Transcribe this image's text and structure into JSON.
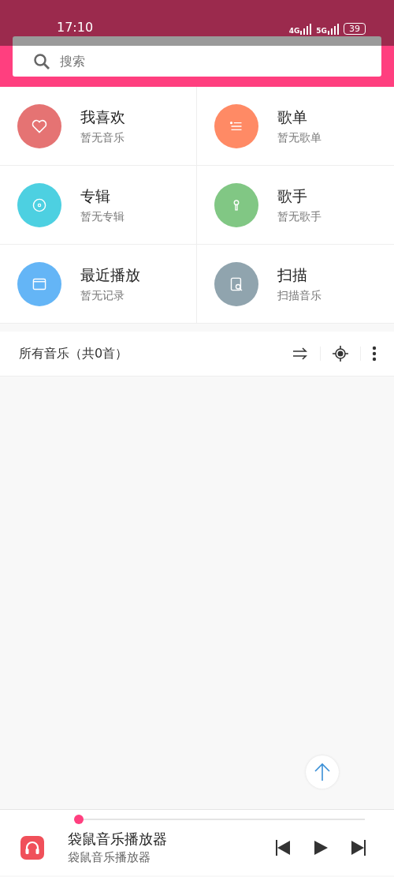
{
  "status_bar": {
    "time": "17:10",
    "networks": [
      "4G",
      "5G"
    ],
    "battery": "39"
  },
  "search": {
    "placeholder": "搜索"
  },
  "categories": [
    {
      "kind": "heart",
      "title": "我喜欢",
      "subtitle": "暂无音乐",
      "color": "#e57373"
    },
    {
      "kind": "list",
      "title": "歌单",
      "subtitle": "暂无歌单",
      "color": "#ff8a65"
    },
    {
      "kind": "disc",
      "title": "专辑",
      "subtitle": "暂无专辑",
      "color": "#4dd0e1"
    },
    {
      "kind": "mic",
      "title": "歌手",
      "subtitle": "暂无歌手",
      "color": "#81c784"
    },
    {
      "kind": "window",
      "title": "最近播放",
      "subtitle": "暂无记录",
      "color": "#64b5f6"
    },
    {
      "kind": "scan",
      "title": "扫描",
      "subtitle": "扫描音乐",
      "color": "#90a4ae"
    }
  ],
  "all_music": {
    "title": "所有音乐（共0首）"
  },
  "player": {
    "title": "袋鼠音乐播放器",
    "subtitle": "袋鼠音乐播放器",
    "level": 0
  }
}
